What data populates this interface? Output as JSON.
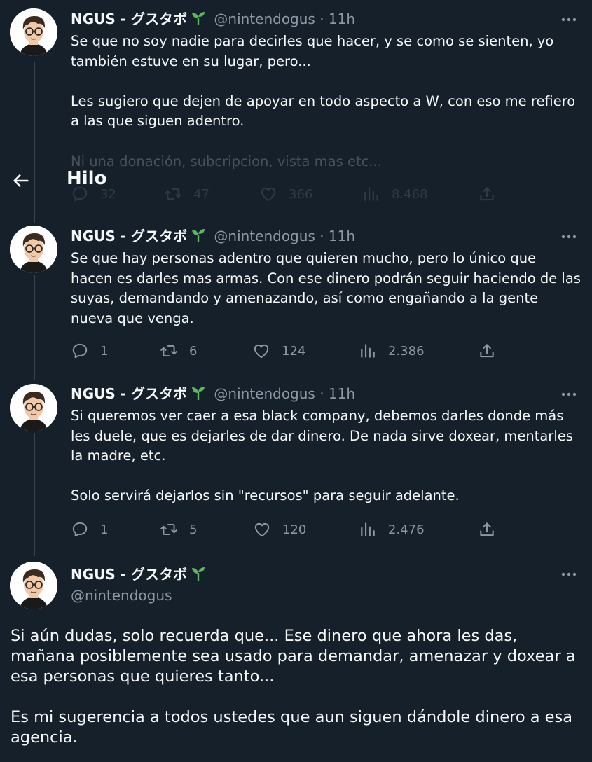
{
  "header": {
    "title": "Hilo",
    "back_icon": "arrow-left-icon"
  },
  "author": {
    "name": "NGUS - グスタボ",
    "handle": "@nintendogus",
    "badge_icon": "sprout-icon"
  },
  "tweets": [
    {
      "time": "11h",
      "paragraphs": [
        "Se que no soy nadie para decirles que hacer, y se como se sienten, yo también estuve en su lugar, pero...",
        "Les sugiero que dejen de apoyar en todo aspecto a W, con eso me refiero a las que siguen adentro.",
        "Ni una donación, subcripcion, vista mas etc..."
      ],
      "replies": "32",
      "retweets": "47",
      "likes": "366",
      "views": "8.468"
    },
    {
      "time": "11h",
      "paragraphs": [
        "Se que hay personas adentro que quieren mucho, pero lo único que hacen es darles mas armas. Con ese dinero podrán seguir haciendo de las suyas, demandando y amenazando, así como engañando a la gente nueva que venga."
      ],
      "replies": "1",
      "retweets": "6",
      "likes": "124",
      "views": "2.386"
    },
    {
      "time": "11h",
      "paragraphs": [
        "Si queremos ver caer a esa black company, debemos darles donde más les duele, que es dejarles de dar dinero. De nada sirve doxear, mentarles la madre, etc.",
        "Solo servirá dejarlos sin \"recursos\" para seguir adelante."
      ],
      "replies": "1",
      "retweets": "5",
      "likes": "120",
      "views": "2.476"
    }
  ],
  "main_tweet": {
    "paragraphs": [
      "Si aún dudas, solo recuerda que... Ese dinero que ahora les das, mañana posiblemente sea usado para demandar, amenazar y doxear a esa personas que quieres tanto...",
      "Es mi sugerencia a todos ustedes que aun siguen dándole dinero a esa agencia."
    ]
  },
  "colors": {
    "background": "#15202b",
    "text": "#f7f9f9",
    "muted": "#8b98a5",
    "line": "#38444d",
    "sprout": "#5cb85c"
  }
}
